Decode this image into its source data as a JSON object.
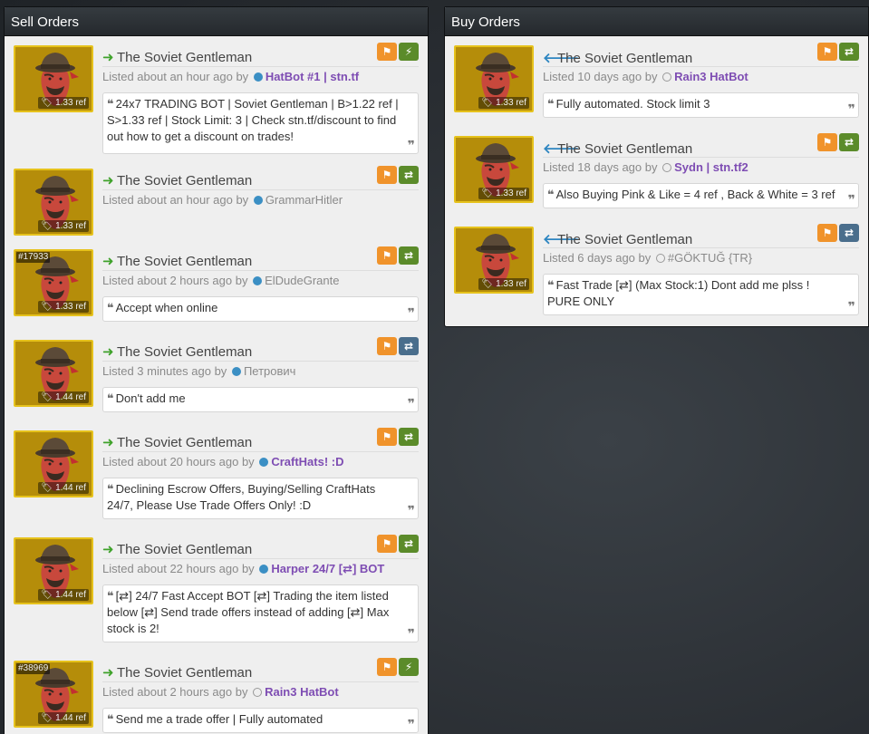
{
  "sell_orders": {
    "title": "Sell Orders",
    "listings": [
      {
        "item": "The Soviet Gentleman",
        "price": "1.33 ref",
        "listed": "Listed about an hour ago by",
        "user": "HatBot #1 | stn.tf",
        "online": true,
        "vip": true,
        "action": "bolt",
        "comment": "24x7 TRADING BOT | Soviet Gentleman | B>1.22 ref | S>1.33 ref | Stock Limit: 3 | Check stn.tf/discount to find out how to get a discount on trades!"
      },
      {
        "item": "The Soviet Gentleman",
        "price": "1.33 ref",
        "listed": "Listed about an hour ago by",
        "user": "GrammarHitler",
        "online": true,
        "vip": false,
        "action": "trade",
        "comment": ""
      },
      {
        "item": "The Soviet Gentleman",
        "price": "1.33 ref",
        "craft": "#17933",
        "listed": "Listed about 2 hours ago by",
        "user": "ElDudeGrante",
        "online": true,
        "vip": false,
        "action": "trade",
        "comment": "Accept when online"
      },
      {
        "item": "The Soviet Gentleman",
        "price": "1.44 ref",
        "listed": "Listed 3 minutes ago by",
        "user": "Петрович",
        "online": true,
        "vip": false,
        "action": "blue",
        "comment": "Don't add me"
      },
      {
        "item": "The Soviet Gentleman",
        "price": "1.44 ref",
        "listed": "Listed about 20 hours ago by",
        "user": "CraftHats! :D",
        "online": true,
        "vip": true,
        "action": "trade",
        "comment": "Declining Escrow Offers, Buying/Selling CraftHats 24/7, Please Use Trade Offers Only! :D"
      },
      {
        "item": "The Soviet Gentleman",
        "price": "1.44 ref",
        "listed": "Listed about 22 hours ago by",
        "user": "Harper 24/7 [⇄] BOT",
        "online": true,
        "vip": true,
        "action": "trade",
        "comment": "[⇄] 24/7 Fast Accept BOT [⇄] Trading the item listed below [⇄] Send trade offers instead of adding [⇄] Max stock is 2!"
      },
      {
        "item": "The Soviet Gentleman",
        "price": "1.44 ref",
        "craft": "#38969",
        "listed": "Listed about 2 hours ago by",
        "user": "Rain3 HatBot",
        "online": false,
        "vip": true,
        "action": "bolt",
        "comment": "Send me a trade offer | Fully automated"
      }
    ]
  },
  "buy_orders": {
    "title": "Buy Orders",
    "listings": [
      {
        "item": "The Soviet Gentleman",
        "price": "1.33 ref",
        "listed": "Listed 10 days ago by",
        "user": "Rain3 HatBot",
        "online": false,
        "vip": true,
        "action": "trade",
        "comment": "Fully automated. Stock limit 3"
      },
      {
        "item": "The Soviet Gentleman",
        "price": "1.33 ref",
        "listed": "Listed 18 days ago by",
        "user": "Sydn | stn.tf2",
        "online": false,
        "vip": true,
        "action": "trade",
        "comment": "Also Buying Pink & Like = 4 ref , Back & White = 3 ref"
      },
      {
        "item": "The Soviet Gentleman",
        "price": "1.33 ref",
        "listed": "Listed 6 days ago by",
        "user": "#GÖKTUĞ {TR}",
        "online": false,
        "vip": false,
        "action": "blue",
        "comment": "Fast Trade [⇄] (Max Stock:1) Dont add me plss ! PURE ONLY"
      }
    ]
  },
  "icons": {
    "sell_arrow": "arrow-right-icon",
    "buy_arrow": "arrow-left-icon",
    "flag": "flag-icon",
    "trade": "exchange-icon",
    "bolt": "lightning-icon",
    "tag": "price-tag-icon",
    "quote": "quote-icon"
  },
  "colors": {
    "sell_arrow": "#3fa22b",
    "buy_arrow": "#2e86c1",
    "flag_btn": "#f0932b",
    "trade_btn": "#5b8b2a",
    "blue_btn": "#4a6e8c",
    "vip_user": "#7e4db3",
    "online_dot": "#3b8fc4",
    "item_bg": "#b58d0a"
  }
}
